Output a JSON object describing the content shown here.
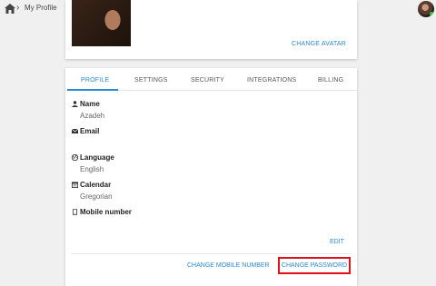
{
  "breadcrumb": {
    "home_icon": "home-icon",
    "separator": "›",
    "current": "My Profile"
  },
  "header": {
    "user_avatar_status": "online",
    "status_color": "#2ecc40"
  },
  "avatar_card": {
    "change_avatar_label": "CHANGE AVATAR"
  },
  "tabs": [
    {
      "label": "PROFILE",
      "active": true
    },
    {
      "label": "SETTINGS",
      "active": false
    },
    {
      "label": "SECURITY",
      "active": false
    },
    {
      "label": "INTEGRATIONS",
      "active": false
    },
    {
      "label": "BILLING",
      "active": false
    }
  ],
  "fields": {
    "name": {
      "label": "Name",
      "value": "Azadeh",
      "icon": "person-icon"
    },
    "email": {
      "label": "Email",
      "value": "",
      "icon": "envelope-icon"
    },
    "language": {
      "label": "Language",
      "value": "English",
      "icon": "globe-icon"
    },
    "calendar": {
      "label": "Calendar",
      "value": "Gregorian",
      "icon": "calendar-icon"
    },
    "mobile": {
      "label": "Mobile number",
      "value": "",
      "icon": "mobile-icon"
    }
  },
  "actions": {
    "edit": "EDIT",
    "change_mobile": "CHANGE MOBILE NUMBER",
    "change_password": "CHANGE PASSWORD"
  },
  "colors": {
    "accent": "#2a8ad4",
    "highlight_border": "#e0101a",
    "background": "#f0f0f0"
  }
}
